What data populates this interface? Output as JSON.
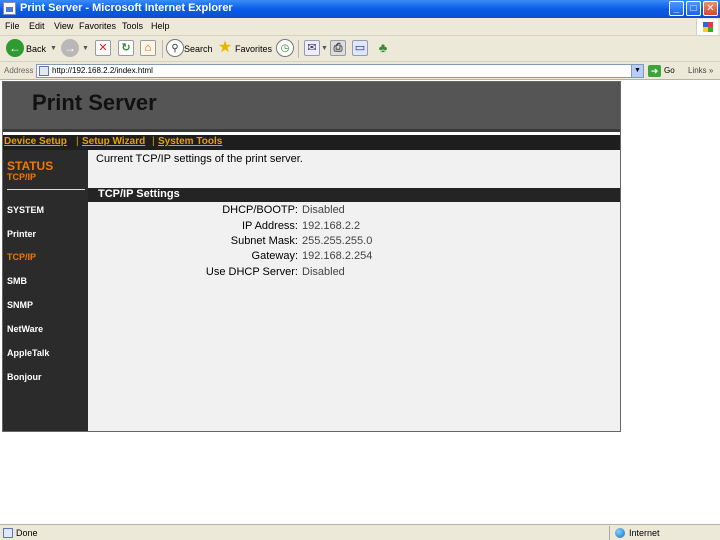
{
  "window": {
    "title": "Print Server - Microsoft Internet Explorer",
    "minimize": "_",
    "maximize": "□",
    "close": "✕"
  },
  "menu": {
    "items": [
      "File",
      "Edit",
      "View",
      "Favorites",
      "Tools",
      "Help"
    ]
  },
  "toolbar": {
    "back_label": "Back",
    "search_label": "Search",
    "favorites_label": "Favorites"
  },
  "address": {
    "label": "Address",
    "url": "http://192.168.2.2/index.html",
    "go_label": "Go",
    "links_label": "Links",
    "links_chevron": "»"
  },
  "page": {
    "banner_title": "Print Server",
    "topnav": [
      "Device Setup",
      "Setup Wizard",
      "System Tools"
    ],
    "topnav_seps": [
      "|",
      "|"
    ],
    "sidebar": {
      "status_title": "STATUS",
      "status_subtitle": "TCP/IP",
      "items": [
        "SYSTEM",
        "Printer",
        "TCP/IP",
        "SMB",
        "SNMP",
        "NetWare",
        "AppleTalk",
        "Bonjour"
      ],
      "active_index": 2
    },
    "intro": "Current TCP/IP settings of the print server.",
    "section_title": "TCP/IP Settings",
    "settings": [
      {
        "label": "DHCP/BOOTP:",
        "value": "Disabled"
      },
      {
        "label": "IP Address:",
        "value": "192.168.2.2"
      },
      {
        "label": "Subnet Mask:",
        "value": "255.255.255.0"
      },
      {
        "label": "Gateway:",
        "value": "192.168.2.254"
      },
      {
        "label": "Use DHCP Server:",
        "value": "Disabled"
      }
    ]
  },
  "statusbar": {
    "status": "Done",
    "zone": "Internet"
  },
  "colors": {
    "accent_orange": "#f07a00",
    "nav_gold": "#e8a000",
    "xp_blue": "#0a5ce8"
  }
}
